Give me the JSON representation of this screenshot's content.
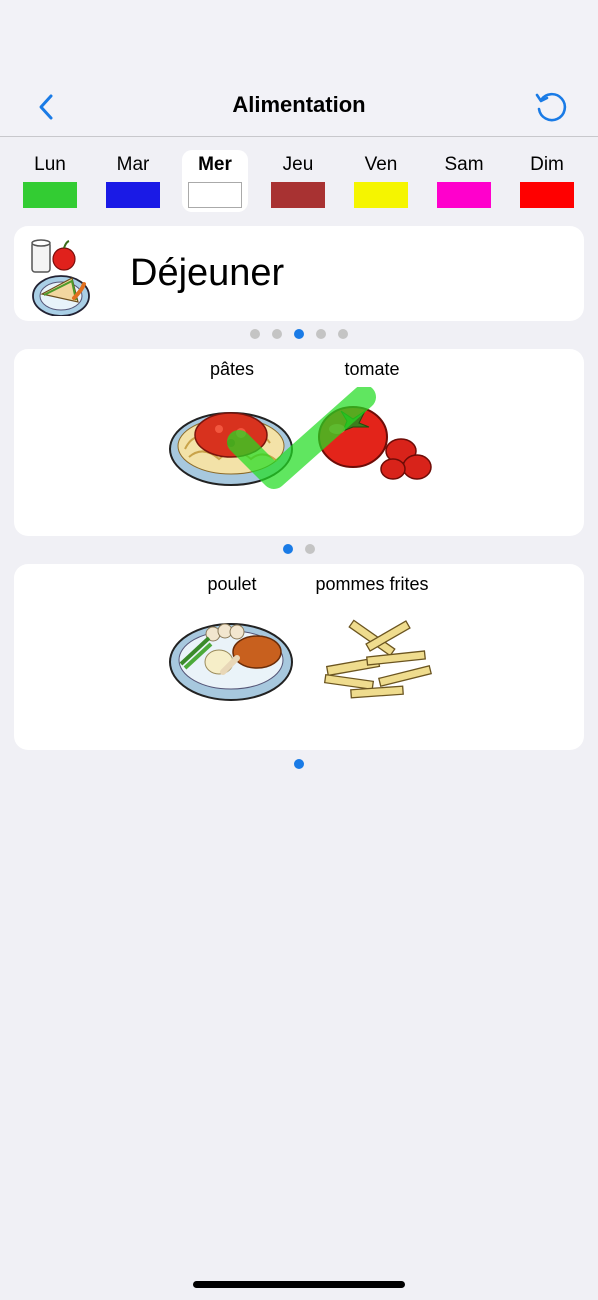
{
  "header": {
    "title": "Alimentation"
  },
  "icons": {
    "back": "chevron-left-icon",
    "refresh": "refresh-icon"
  },
  "accent": "#1a7be6",
  "days": [
    {
      "label": "Lun",
      "color": "#33cc33",
      "selected": false
    },
    {
      "label": "Mar",
      "color": "#1a1ae6",
      "selected": false
    },
    {
      "label": "Mer",
      "color": "#ffffff",
      "selected": true
    },
    {
      "label": "Jeu",
      "color": "#a83232",
      "selected": false
    },
    {
      "label": "Ven",
      "color": "#f5f500",
      "selected": false
    },
    {
      "label": "Sam",
      "color": "#ff00cc",
      "selected": false
    },
    {
      "label": "Dim",
      "color": "#ff0000",
      "selected": false
    }
  ],
  "meal": {
    "name": "Déjeuner"
  },
  "meal_pager": {
    "count": 5,
    "active": 2
  },
  "groups": [
    {
      "items": [
        {
          "label": "pâtes",
          "icon": "pasta-icon"
        },
        {
          "label": "tomate",
          "icon": "tomato-icon"
        }
      ],
      "checked": true,
      "pager": {
        "count": 2,
        "active": 0
      }
    },
    {
      "items": [
        {
          "label": "poulet",
          "icon": "chicken-plate-icon"
        },
        {
          "label": "pommes frites",
          "icon": "french-fries-icon"
        }
      ],
      "checked": false,
      "pager": {
        "count": 1,
        "active": 0
      }
    }
  ]
}
